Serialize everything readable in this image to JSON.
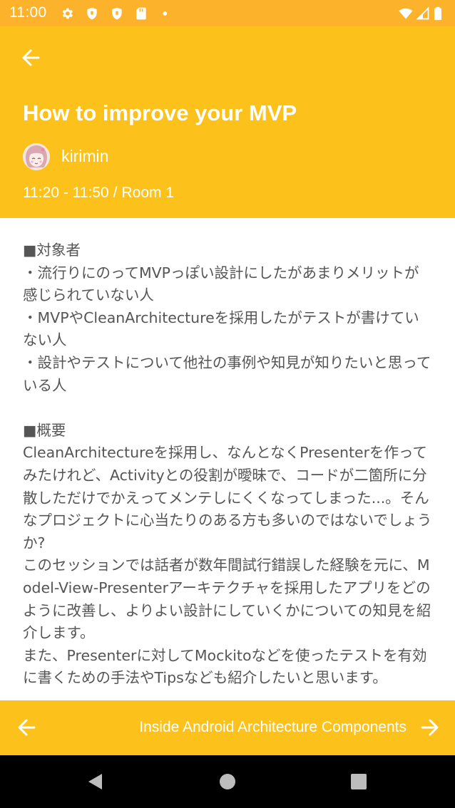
{
  "status_bar": {
    "time": "11:00",
    "icons": [
      "gear-icon",
      "shield-icon",
      "shield-icon",
      "sd-card-icon",
      "dot-icon",
      "wifi-icon",
      "signal-icon",
      "battery-icon"
    ]
  },
  "colors": {
    "header": "#fcc21b",
    "status_bar": "#fcb22a",
    "body_text": "#555555"
  },
  "header": {
    "back_icon": "arrow-left-icon",
    "title": "How to improve your MVP",
    "speaker": "kirimin",
    "time": "11:20 - 11:50",
    "separator": "/",
    "room": "Room 1"
  },
  "description": [
    "■対象者\n・流行りにのってMVPっぽい設計にしたがあまりメリットが感じられていない人\n・MVPやCleanArchitectureを採用したがテストが書けていない人\n・設計やテストについて他社の事例や知見が知りたいと思っている人",
    "■概要\nCleanArchitectureを採用し、なんとなくPresenterを作ってみたけれど、Activityとの役割が曖昧で、コードが二箇所に分散しただけでかえってメンテしにくくなってしまった...。そんなプロジェクトに心当たりのある方も多いのではないでしょうか?\nこのセッションでは話者が数年間試行錯誤した経験を元に、Model-View-Presenterアーキテクチャを採用したアプリをどのように改善し、よりよい設計にしていくかについての知見を紹介します。\nまた、Presenterに対してMockitoなどを使ったテストを有効に書くための手法やTipsなども紹介したいと思います。"
  ],
  "bottom_nav": {
    "prev_icon": "arrow-left-icon",
    "next_title": "Inside Android Architecture Components",
    "next_icon": "arrow-right-icon"
  },
  "system_nav": {
    "icons": [
      "back-triangle-icon",
      "home-circle-icon",
      "recents-square-icon"
    ]
  }
}
